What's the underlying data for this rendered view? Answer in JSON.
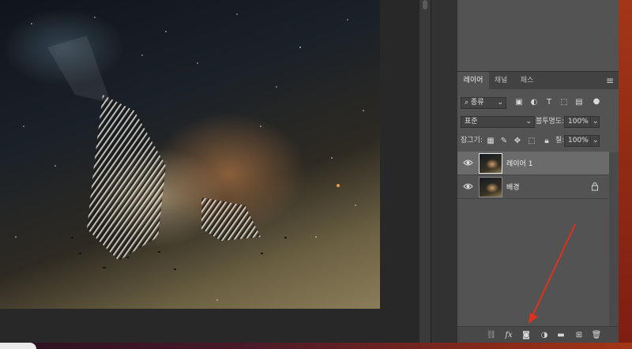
{
  "layers_panel": {
    "tabs": [
      {
        "label": "레이어",
        "active": true
      },
      {
        "label": "채널",
        "active": false
      },
      {
        "label": "패스",
        "active": false
      }
    ],
    "filter_kind": "종류",
    "blend_mode": "표준",
    "opacity_label": "불투명도:",
    "opacity_value": "100%",
    "lock_label": "잠그기:",
    "fill_label": "칠:",
    "fill_value": "100%",
    "layers": [
      {
        "name": "레이어 1",
        "visible": true,
        "selected": true,
        "locked": false
      },
      {
        "name": "배경",
        "visible": true,
        "selected": false,
        "locked": true
      }
    ],
    "bottom_icons": [
      "link-icon",
      "fx-icon",
      "mask-icon",
      "adjustment-icon",
      "folder-icon",
      "new-layer-icon",
      "trash-icon"
    ],
    "fx_label": "fx"
  },
  "colors": {
    "panel_bg": "#535353",
    "selected_layer": "#6b6b6b",
    "annotation_arrow": "#e0301e"
  }
}
